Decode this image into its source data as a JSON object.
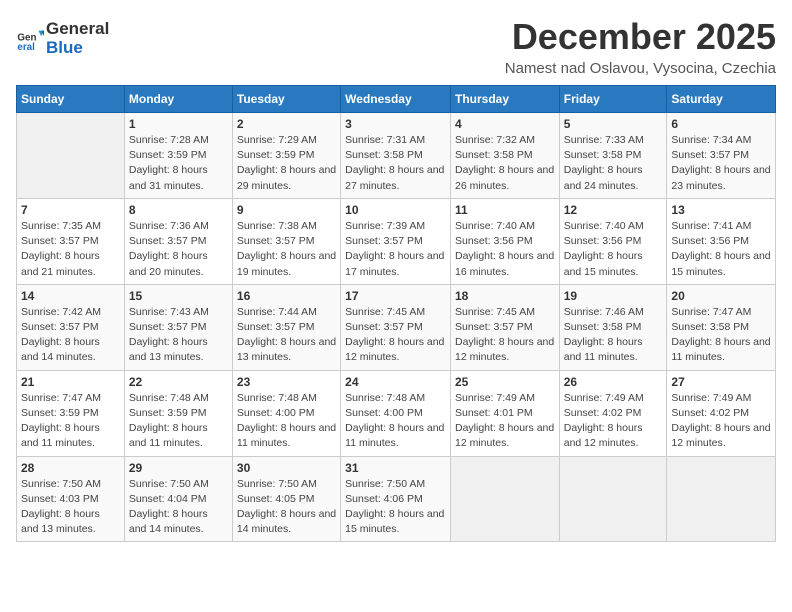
{
  "logo": {
    "line1": "General",
    "line2": "Blue"
  },
  "title": "December 2025",
  "subtitle": "Namest nad Oslavou, Vysocina, Czechia",
  "headers": [
    "Sunday",
    "Monday",
    "Tuesday",
    "Wednesday",
    "Thursday",
    "Friday",
    "Saturday"
  ],
  "weeks": [
    [
      {
        "day": "",
        "empty": true
      },
      {
        "day": "1",
        "sunrise": "7:28 AM",
        "sunset": "3:59 PM",
        "daylight": "8 hours and 31 minutes."
      },
      {
        "day": "2",
        "sunrise": "7:29 AM",
        "sunset": "3:59 PM",
        "daylight": "8 hours and 29 minutes."
      },
      {
        "day": "3",
        "sunrise": "7:31 AM",
        "sunset": "3:58 PM",
        "daylight": "8 hours and 27 minutes."
      },
      {
        "day": "4",
        "sunrise": "7:32 AM",
        "sunset": "3:58 PM",
        "daylight": "8 hours and 26 minutes."
      },
      {
        "day": "5",
        "sunrise": "7:33 AM",
        "sunset": "3:58 PM",
        "daylight": "8 hours and 24 minutes."
      },
      {
        "day": "6",
        "sunrise": "7:34 AM",
        "sunset": "3:57 PM",
        "daylight": "8 hours and 23 minutes."
      }
    ],
    [
      {
        "day": "7",
        "sunrise": "7:35 AM",
        "sunset": "3:57 PM",
        "daylight": "8 hours and 21 minutes."
      },
      {
        "day": "8",
        "sunrise": "7:36 AM",
        "sunset": "3:57 PM",
        "daylight": "8 hours and 20 minutes."
      },
      {
        "day": "9",
        "sunrise": "7:38 AM",
        "sunset": "3:57 PM",
        "daylight": "8 hours and 19 minutes."
      },
      {
        "day": "10",
        "sunrise": "7:39 AM",
        "sunset": "3:57 PM",
        "daylight": "8 hours and 17 minutes."
      },
      {
        "day": "11",
        "sunrise": "7:40 AM",
        "sunset": "3:56 PM",
        "daylight": "8 hours and 16 minutes."
      },
      {
        "day": "12",
        "sunrise": "7:40 AM",
        "sunset": "3:56 PM",
        "daylight": "8 hours and 15 minutes."
      },
      {
        "day": "13",
        "sunrise": "7:41 AM",
        "sunset": "3:56 PM",
        "daylight": "8 hours and 15 minutes."
      }
    ],
    [
      {
        "day": "14",
        "sunrise": "7:42 AM",
        "sunset": "3:57 PM",
        "daylight": "8 hours and 14 minutes."
      },
      {
        "day": "15",
        "sunrise": "7:43 AM",
        "sunset": "3:57 PM",
        "daylight": "8 hours and 13 minutes."
      },
      {
        "day": "16",
        "sunrise": "7:44 AM",
        "sunset": "3:57 PM",
        "daylight": "8 hours and 13 minutes."
      },
      {
        "day": "17",
        "sunrise": "7:45 AM",
        "sunset": "3:57 PM",
        "daylight": "8 hours and 12 minutes."
      },
      {
        "day": "18",
        "sunrise": "7:45 AM",
        "sunset": "3:57 PM",
        "daylight": "8 hours and 12 minutes."
      },
      {
        "day": "19",
        "sunrise": "7:46 AM",
        "sunset": "3:58 PM",
        "daylight": "8 hours and 11 minutes."
      },
      {
        "day": "20",
        "sunrise": "7:47 AM",
        "sunset": "3:58 PM",
        "daylight": "8 hours and 11 minutes."
      }
    ],
    [
      {
        "day": "21",
        "sunrise": "7:47 AM",
        "sunset": "3:59 PM",
        "daylight": "8 hours and 11 minutes."
      },
      {
        "day": "22",
        "sunrise": "7:48 AM",
        "sunset": "3:59 PM",
        "daylight": "8 hours and 11 minutes."
      },
      {
        "day": "23",
        "sunrise": "7:48 AM",
        "sunset": "4:00 PM",
        "daylight": "8 hours and 11 minutes."
      },
      {
        "day": "24",
        "sunrise": "7:48 AM",
        "sunset": "4:00 PM",
        "daylight": "8 hours and 11 minutes."
      },
      {
        "day": "25",
        "sunrise": "7:49 AM",
        "sunset": "4:01 PM",
        "daylight": "8 hours and 12 minutes."
      },
      {
        "day": "26",
        "sunrise": "7:49 AM",
        "sunset": "4:02 PM",
        "daylight": "8 hours and 12 minutes."
      },
      {
        "day": "27",
        "sunrise": "7:49 AM",
        "sunset": "4:02 PM",
        "daylight": "8 hours and 12 minutes."
      }
    ],
    [
      {
        "day": "28",
        "sunrise": "7:50 AM",
        "sunset": "4:03 PM",
        "daylight": "8 hours and 13 minutes."
      },
      {
        "day": "29",
        "sunrise": "7:50 AM",
        "sunset": "4:04 PM",
        "daylight": "8 hours and 14 minutes."
      },
      {
        "day": "30",
        "sunrise": "7:50 AM",
        "sunset": "4:05 PM",
        "daylight": "8 hours and 14 minutes."
      },
      {
        "day": "31",
        "sunrise": "7:50 AM",
        "sunset": "4:06 PM",
        "daylight": "8 hours and 15 minutes."
      },
      {
        "day": "",
        "empty": true
      },
      {
        "day": "",
        "empty": true
      },
      {
        "day": "",
        "empty": true
      }
    ]
  ]
}
